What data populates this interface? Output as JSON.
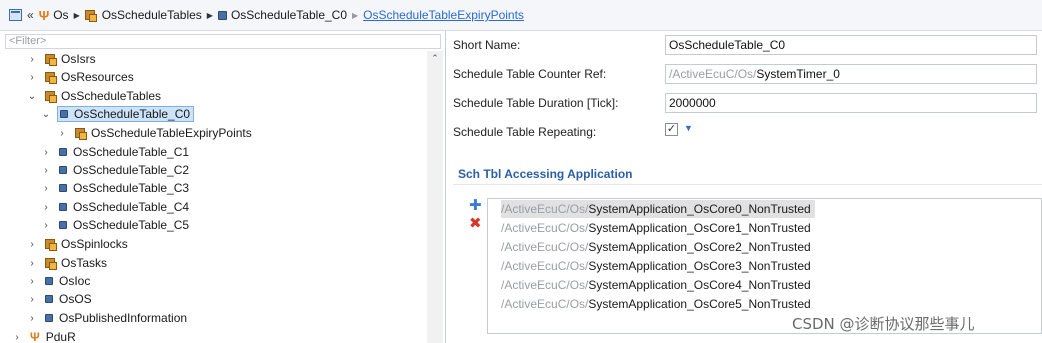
{
  "breadcrumb": {
    "items": [
      {
        "label": "Os",
        "icon": "module-fork-icon"
      },
      {
        "label": "OsScheduleTables",
        "icon": "package-icon"
      },
      {
        "label": "OsScheduleTable_C0",
        "icon": "container-icon"
      },
      {
        "label": "OsScheduleTableExpiryPoints",
        "icon": "none",
        "link": true
      }
    ]
  },
  "tree": {
    "filter_placeholder": "<Filter>",
    "nodes": [
      {
        "label": "OsIsrs",
        "icon": "package-icon",
        "expanded": false
      },
      {
        "label": "OsResources",
        "icon": "package-icon",
        "expanded": false
      },
      {
        "label": "OsScheduleTables",
        "icon": "package-icon",
        "expanded": true
      },
      {
        "label": "OsScheduleTable_C0",
        "icon": "container-icon",
        "expanded": true,
        "selected": true
      },
      {
        "label": "OsScheduleTableExpiryPoints",
        "icon": "package-icon",
        "expanded": false
      },
      {
        "label": "OsScheduleTable_C1",
        "icon": "container-icon",
        "expanded": false
      },
      {
        "label": "OsScheduleTable_C2",
        "icon": "container-icon",
        "expanded": false
      },
      {
        "label": "OsScheduleTable_C3",
        "icon": "container-icon",
        "expanded": false
      },
      {
        "label": "OsScheduleTable_C4",
        "icon": "container-icon",
        "expanded": false
      },
      {
        "label": "OsScheduleTable_C5",
        "icon": "container-icon",
        "expanded": false
      },
      {
        "label": "OsSpinlocks",
        "icon": "package-icon",
        "expanded": false
      },
      {
        "label": "OsTasks",
        "icon": "package-icon",
        "expanded": false
      },
      {
        "label": "OsIoc",
        "icon": "container-icon",
        "expanded": false
      },
      {
        "label": "OsOS",
        "icon": "container-icon",
        "expanded": false
      },
      {
        "label": "OsPublishedInformation",
        "icon": "container-icon",
        "expanded": false
      },
      {
        "label": "PduR",
        "icon": "module-fork-icon",
        "expanded": false
      }
    ]
  },
  "properties": {
    "short_name_label": "Short Name:",
    "short_name_value": "OsScheduleTable_C0",
    "counter_ref_label": "Schedule Table Counter Ref:",
    "counter_ref_prefix": "/ActiveEcuC/Os/",
    "counter_ref_value": "SystemTimer_0",
    "duration_label": "Schedule Table Duration [Tick]:",
    "duration_value": "2000000",
    "repeating_label": "Schedule Table Repeating:",
    "repeating_checked": true,
    "repeating_check_glyph": "✓"
  },
  "accessing": {
    "title": "Sch Tbl Accessing Application",
    "items": [
      {
        "prefix": "/ActiveEcuC/Os/",
        "name": "SystemApplication_OsCore0_NonTrusted",
        "selected": true
      },
      {
        "prefix": "/ActiveEcuC/Os/",
        "name": "SystemApplication_OsCore1_NonTrusted"
      },
      {
        "prefix": "/ActiveEcuC/Os/",
        "name": "SystemApplication_OsCore2_NonTrusted"
      },
      {
        "prefix": "/ActiveEcuC/Os/",
        "name": "SystemApplication_OsCore3_NonTrusted"
      },
      {
        "prefix": "/ActiveEcuC/Os/",
        "name": "SystemApplication_OsCore4_NonTrusted"
      },
      {
        "prefix": "/ActiveEcuC/Os/",
        "name": "SystemApplication_OsCore5_NonTrusted"
      }
    ]
  },
  "watermark": "CSDN @诊断协议那些事儿",
  "colors": {
    "link": "#2a6ad1",
    "section_title": "#2a5ea8",
    "selection": "#cde3f8",
    "delete": "#d9362b",
    "add": "#3b7bd6"
  }
}
